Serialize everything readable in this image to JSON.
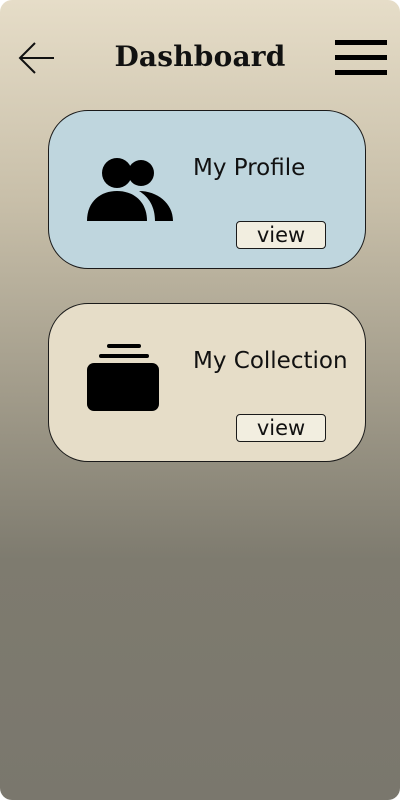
{
  "header": {
    "title": "Dashboard",
    "back_icon": "arrow-left-icon",
    "menu_icon": "hamburger-menu-icon"
  },
  "cards": [
    {
      "label": "My Profile",
      "button_label": "view",
      "icon": "users-icon",
      "background": "#bfd6de"
    },
    {
      "label": "My Collection",
      "button_label": "view",
      "icon": "collection-box-icon",
      "background": "#e6ddc8"
    }
  ]
}
